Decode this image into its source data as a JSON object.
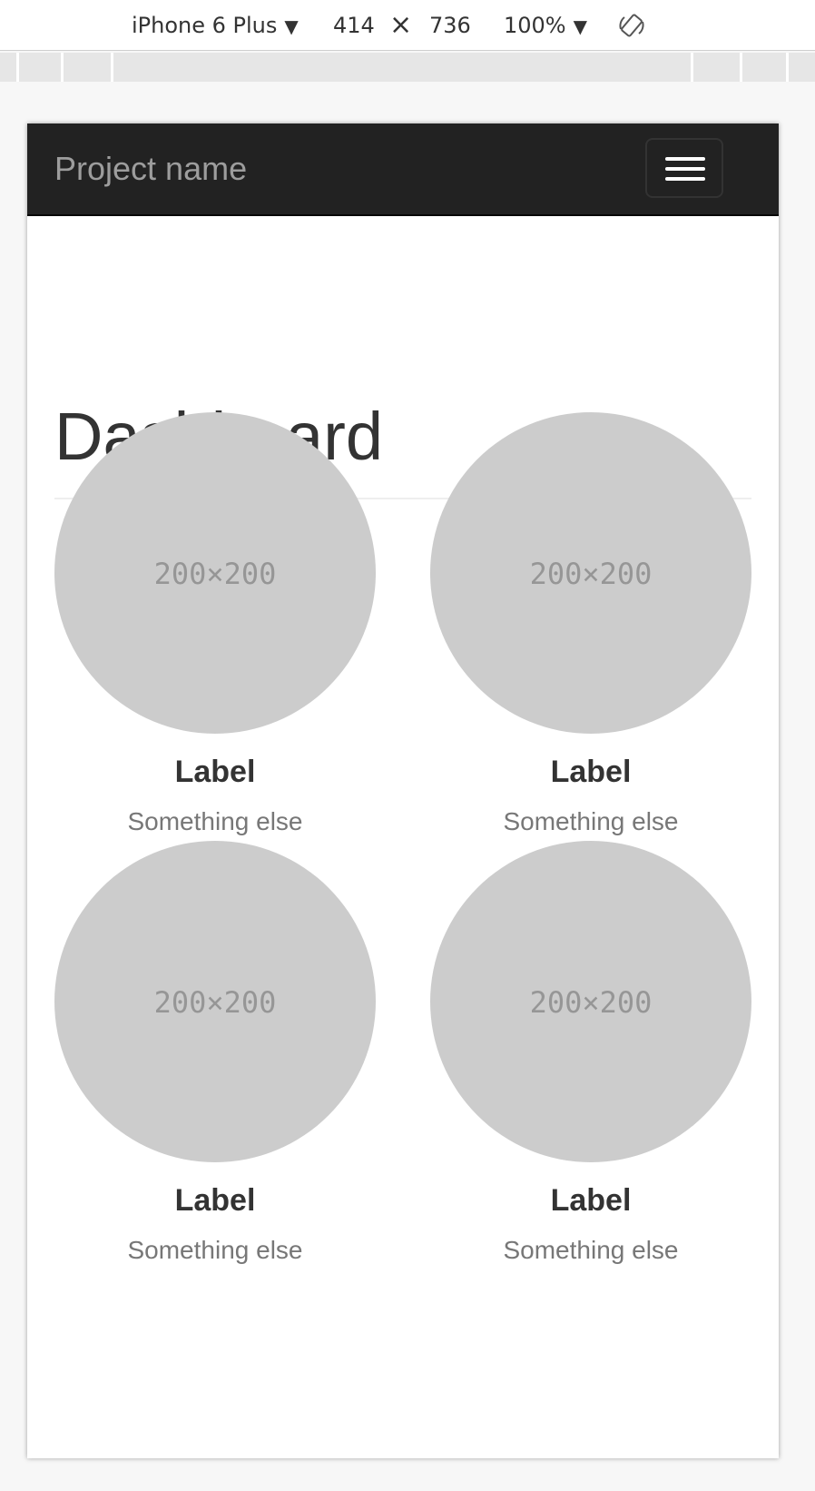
{
  "devtools": {
    "device": "iPhone 6 Plus",
    "width": "414",
    "times": "×",
    "height": "736",
    "zoom": "100%",
    "caret": "▼",
    "rotate_icon": "rotate-icon"
  },
  "navbar": {
    "brand": "Project name",
    "toggle_icon": "hamburger-menu-icon"
  },
  "page": {
    "title": "Dashboard"
  },
  "placeholders": [
    {
      "image_text": "200×200",
      "label": "Label",
      "sub": "Something else"
    },
    {
      "image_text": "200×200",
      "label": "Label",
      "sub": "Something else"
    },
    {
      "image_text": "200×200",
      "label": "Label",
      "sub": "Something else"
    },
    {
      "image_text": "200×200",
      "label": "Label",
      "sub": "Something else"
    }
  ],
  "colors": {
    "navbar_bg": "#222222",
    "brand_text": "#9d9d9d",
    "placeholder_circle": "#cccccc",
    "heading_text": "#333333",
    "muted_text": "#777777"
  }
}
